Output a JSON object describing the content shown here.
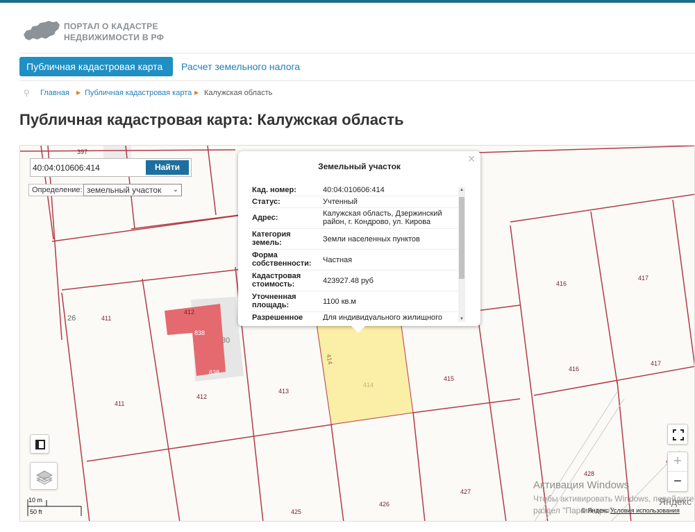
{
  "header": {
    "logo_line1": "ПОРТАЛ О КАДАСТРЕ",
    "logo_line2": "НЕДВИЖИМОСТИ В РФ"
  },
  "nav": {
    "tabs": [
      {
        "label": "Публичная кадастровая карта",
        "active": true
      },
      {
        "label": "Расчет земельного налога",
        "active": false
      }
    ]
  },
  "breadcrumb": {
    "items": [
      "Главная",
      "Публичная кадастровая карта",
      "Калужская область"
    ]
  },
  "page_title": "Публичная кадастровая карта: Калужская область",
  "map": {
    "search": {
      "value": "40:04:010606:414",
      "button": "Найти"
    },
    "definition": {
      "label": "Определение:",
      "selected": "земельный участок"
    },
    "popup": {
      "title": "Земельный участок",
      "rows": [
        {
          "key": "Кад. номер:",
          "value": "40:04:010606:414"
        },
        {
          "key": "Статус:",
          "value": "Учтенный"
        },
        {
          "key": "Адрес:",
          "value": "Калужская область, Дзержинский район, г. Кондрово, ул. Кирова"
        },
        {
          "key": "Категория земель:",
          "value": "Земли населенных пунктов"
        },
        {
          "key": "Форма собственности:",
          "value": "Частная"
        },
        {
          "key": "Кадастровая стоимость:",
          "value": "423927.48 руб"
        },
        {
          "key": "Уточненная площадь:",
          "value": "1100 кв.м"
        },
        {
          "key": "Разрешенное",
          "value": "Для индивидуального жилищного"
        }
      ]
    },
    "parcel_labels": {
      "p397": "397",
      "p26": "26",
      "p411a": "411",
      "p411b": "411",
      "p412a": "412",
      "p412b": "412",
      "p838a": "838",
      "p838b": "838",
      "p30": "30",
      "p413": "413",
      "p414": "414",
      "p414v": "414",
      "p415": "415",
      "p416a": "416",
      "p416b": "416",
      "p417a": "417",
      "p417b": "417",
      "p425": "425",
      "p426": "426",
      "p427": "427",
      "p428": "428",
      "p4": "4"
    },
    "scale": {
      "metric": "10 m",
      "imperial": "50 ft"
    },
    "zoom": {
      "in": "+",
      "out": "−"
    },
    "watermark": {
      "line1": "Активация Windows",
      "line2": "Чтобы активировать Windows, перейдите в",
      "line3": "раздел \"Параметры\"."
    },
    "yandex_logo": "Яндекс",
    "copyright_prefix": "© Яндекс",
    "terms_link": "Условия использования"
  },
  "colors": {
    "accent": "#1f8fc4",
    "selected_parcel": "#fbeea6",
    "building": "#e46a6f",
    "boundary": "#b23a48"
  },
  "icons": [
    "russia-map-logo-icon",
    "location-pin-icon",
    "close-icon",
    "legend-icon",
    "layers-icon",
    "fullscreen-icon"
  ]
}
